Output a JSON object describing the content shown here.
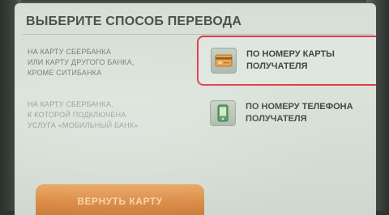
{
  "screen": {
    "title": "ВЫБЕРИТЕ СПОСОБ ПЕРЕВОДА"
  },
  "descriptions": {
    "card_transfer": [
      "НА КАРТУ СБЕРБАНКА",
      "ИЛИ КАРТУ ДРУГОГО БАНКА,",
      "КРОМЕ СИТИБАНКА"
    ],
    "phone_transfer": [
      "НА КАРТУ СБЕРБАНКА,",
      "К КОТОРОЙ ПОДКЛЮЧЕНА",
      "УСЛУГА «МОБИЛЬНЫЙ БАНК»"
    ]
  },
  "options": {
    "by_card": {
      "label_line1": "ПО НОМЕРУ КАРТЫ",
      "label_line2": "ПОЛУЧАТЕЛЯ",
      "icon": "bank-card-icon",
      "highlighted": true,
      "highlight_color": "#e0394a"
    },
    "by_phone": {
      "label_line1": "ПО НОМЕРУ ТЕЛЕФОНА",
      "label_line2": "ПОЛУЧАТЕЛЯ",
      "icon": "mobile-phone-icon"
    }
  },
  "footer": {
    "back_label": "ВЕРНУТЬ КАРТУ",
    "back_color": "#d98840"
  }
}
